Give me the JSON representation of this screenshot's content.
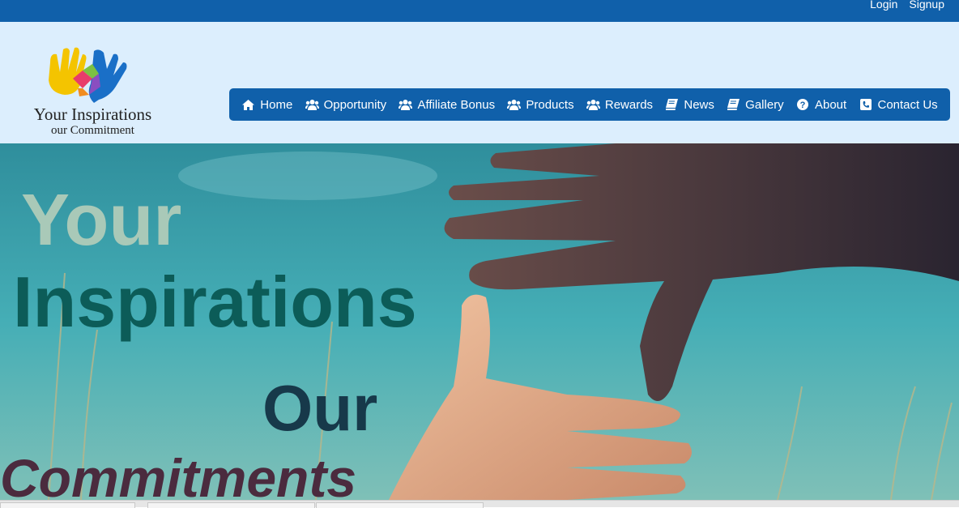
{
  "topbar": {
    "login": "Login",
    "signup": "Signup"
  },
  "logo": {
    "line1": "Your Inspirations",
    "line2": "our Commitment"
  },
  "nav": {
    "items": [
      {
        "label": "Home",
        "icon": "home-icon"
      },
      {
        "label": "Opportunity",
        "icon": "users-icon"
      },
      {
        "label": "Affiliate Bonus",
        "icon": "users-icon"
      },
      {
        "label": "Products",
        "icon": "users-icon"
      },
      {
        "label": "Rewards",
        "icon": "users-icon"
      },
      {
        "label": "News",
        "icon": "book-icon"
      },
      {
        "label": "Gallery",
        "icon": "book-icon"
      },
      {
        "label": "About",
        "icon": "question-circle-icon"
      },
      {
        "label": "Contact Us",
        "icon": "phone-icon"
      }
    ]
  },
  "hero": {
    "line1": "Your",
    "line2": "Inspirations",
    "line3": "Our",
    "line4": "Commitments"
  },
  "colors": {
    "brand": "#1060aa",
    "header_bg": "#dceefd"
  }
}
